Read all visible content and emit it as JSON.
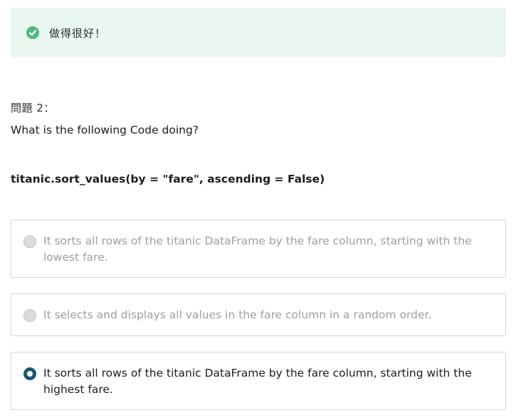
{
  "feedback": {
    "message": "做得很好！",
    "icon": "check-circle-icon",
    "color": "#52b788"
  },
  "question": {
    "label": "問題 2：",
    "prompt": "What is the following Code doing?",
    "code": "titanic.sort_values(by = \"fare\", ascending = False)"
  },
  "options": [
    {
      "text": "It sorts all rows of the titanic DataFrame by the fare column, starting with the lowest fare.",
      "selected": false
    },
    {
      "text": "It selects and displays all values in the fare column in a random order.",
      "selected": false
    },
    {
      "text": "It sorts all rows of the titanic DataFrame by the fare column, starting with the highest fare.",
      "selected": true
    }
  ],
  "colors": {
    "banner_bg": "#eaf7f1",
    "radio_selected": "#1a5a72"
  }
}
